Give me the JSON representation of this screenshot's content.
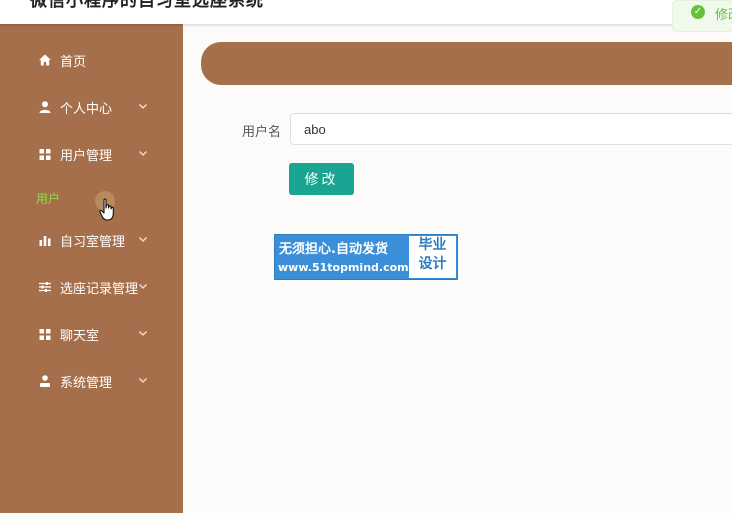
{
  "header": {
    "title": "微信小程序的自习室选座系统"
  },
  "toast": {
    "text": "修改成功",
    "icon": "success-check-icon",
    "color": "#67c23a"
  },
  "sidebar": {
    "items": [
      {
        "label": "首页",
        "icon": "home-icon"
      },
      {
        "label": "个人中心",
        "icon": "user-icon"
      },
      {
        "label": "用户管理",
        "icon": "grid-icon"
      },
      {
        "label": "自习室管理",
        "icon": "bar-chart-icon"
      },
      {
        "label": "选座记录管理",
        "icon": "sliders-icon"
      },
      {
        "label": "聊天室",
        "icon": "grid-icon"
      },
      {
        "label": "系统管理",
        "icon": "person-icon"
      }
    ],
    "sub_item": {
      "label": "用户"
    }
  },
  "form": {
    "username_label": "用户名",
    "username_value": "abo",
    "submit_label": "修改"
  },
  "watermark": {
    "line1": "无须担心.自动发货",
    "line2": "www.51topmind.com",
    "box_line1": "毕业",
    "box_line2": "设计"
  },
  "colors": {
    "sidebar_bg": "#a66f4c",
    "accent": "#19a591",
    "submenu_active": "#8fdc4a"
  }
}
